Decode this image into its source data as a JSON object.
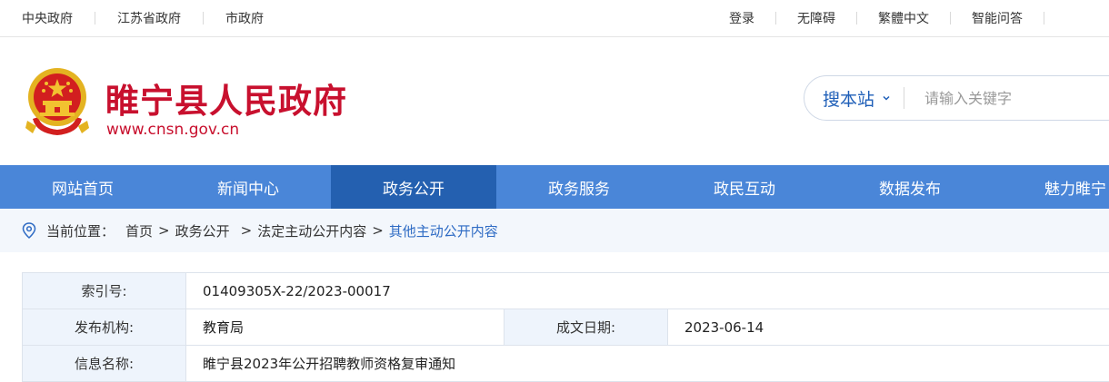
{
  "topbar": {
    "left_links": [
      "中央政府",
      "江苏省政府",
      "市政府"
    ],
    "right_links": [
      "登录",
      "无障碍",
      "繁體中文",
      "智能问答"
    ]
  },
  "header": {
    "title": "睢宁县人民政府",
    "url": "www.cnsn.gov.cn",
    "emblem_icon": "national-emblem-icon"
  },
  "search": {
    "scope_label": "搜本站",
    "placeholder": "请输入关键字"
  },
  "nav": {
    "items": [
      "网站首页",
      "新闻中心",
      "政务公开",
      "政务服务",
      "政民互动",
      "数据发布",
      "魅力睢宁"
    ],
    "active_index": 2
  },
  "breadcrumb": {
    "prefix": "当前位置：",
    "items": [
      "首页",
      "政务公开",
      "法定主动公开内容",
      "其他主动公开内容"
    ],
    "separator": ">"
  },
  "info_table": {
    "index_label": "索引号:",
    "index_value": "01409305X-22/2023-00017",
    "org_label": "发布机构:",
    "org_value": "教育局",
    "date_label": "成文日期:",
    "date_value": "2023-06-14",
    "name_label": "信息名称:",
    "name_value": "睢宁县2023年公开招聘教师资格复审通知"
  },
  "colors": {
    "title_red": "#c8102e",
    "nav_blue": "#4a86d8",
    "nav_active": "#2460b0",
    "link_blue": "#2e6bc4"
  }
}
